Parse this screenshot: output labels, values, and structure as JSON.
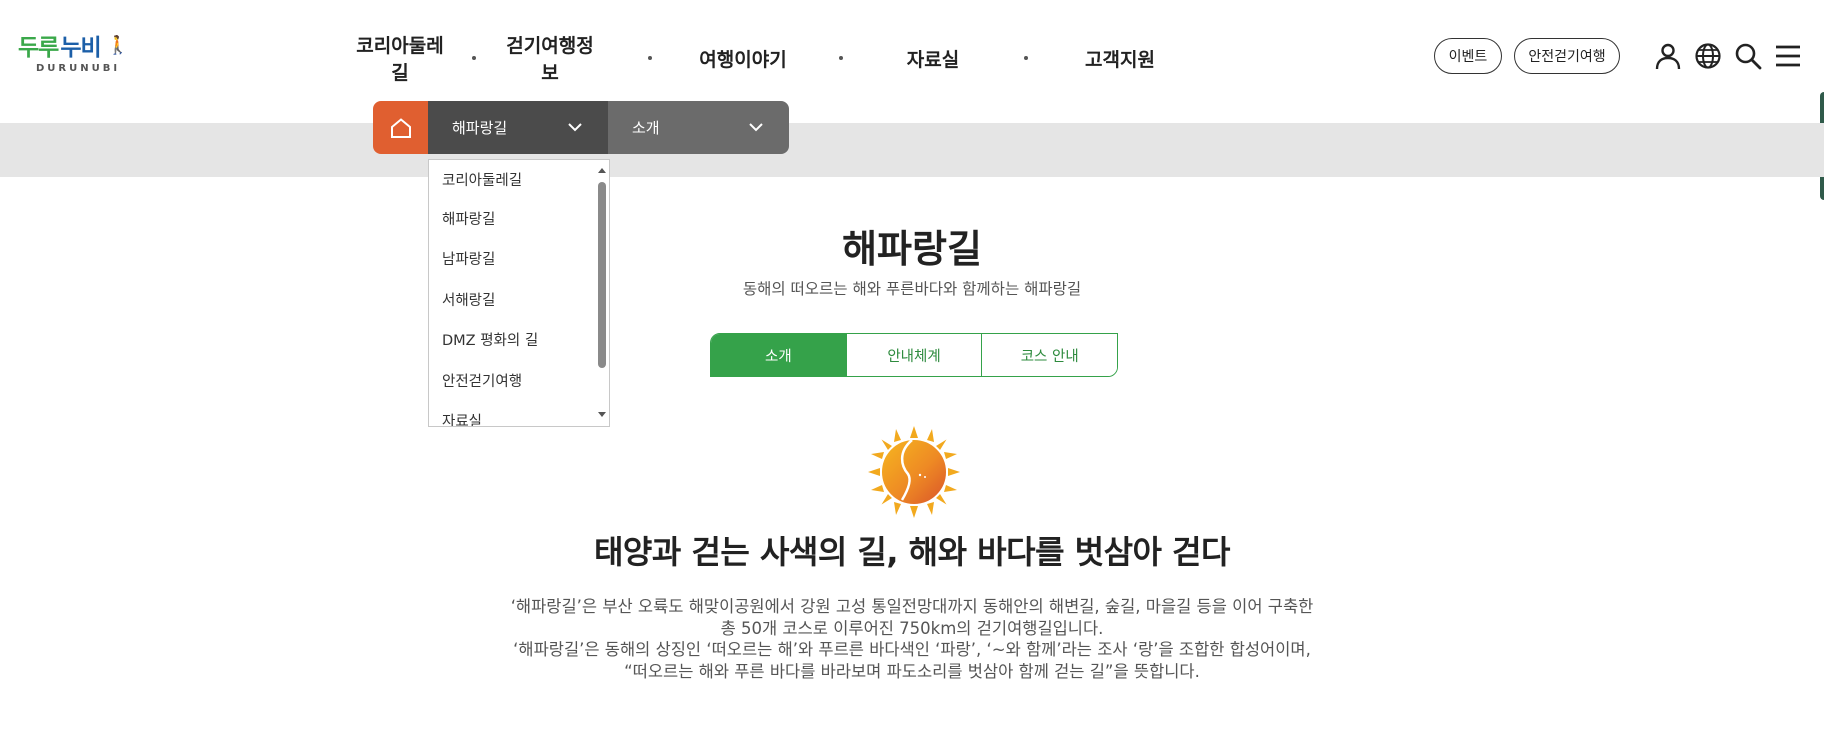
{
  "logo": {
    "text_green": "두루",
    "text_blue": "누비",
    "sub": "DURUNUBI"
  },
  "gnb": [
    "코리아둘레길",
    "걷기여행정보",
    "여행이야기",
    "자료실",
    "고객지원"
  ],
  "util": {
    "event_label": "이벤트",
    "safety_label": "안전걷기여행"
  },
  "icons": {
    "user": "user-icon",
    "globe": "globe-icon",
    "search": "search-icon",
    "menu": "hamburger-icon",
    "home": "home-icon"
  },
  "location": {
    "depth1": "해파랑길",
    "depth2": "소개"
  },
  "dropdown": {
    "items": [
      "코리아둘레길",
      "해파랑길",
      "남파랑길",
      "서해랑길",
      "DMZ 평화의 길",
      "안전걷기여행",
      "자료실"
    ]
  },
  "page": {
    "title": "해파랑길",
    "subtitle": "동해의 떠오르는 해와 푸른바다와 함께하는 해파랑길"
  },
  "tabs": [
    "소개",
    "안내체계",
    "코스 안내"
  ],
  "content": {
    "headline": "태양과 걷는 사색의 길, 해와 바다를 벗삼아 걷다",
    "desc_lines": [
      "‘해파랑길’은 부산 오륙도 해맞이공원에서 강원 고성 통일전망대까지 동해안의 해변길, 숲길, 마을길 등을 이어 구축한",
      "총 50개 코스로 이루어진 750km의 걷기여행길입니다.",
      "‘해파랑길’은 동해의 상징인 ‘떠오르는 해’와 푸르른 바다색인 ‘파랑’, ‘~와 함께’라는 조사 ‘랑’을 조합한 합성어이며,",
      "“떠오르는 해와 푸른 바다를 바라보며 파도소리를 벗삼아 함께 걷는 길”을 뜻합니다."
    ]
  },
  "colors": {
    "green": "#35a24a",
    "orange": "#e05f30",
    "dark": "#4b4b4b"
  }
}
